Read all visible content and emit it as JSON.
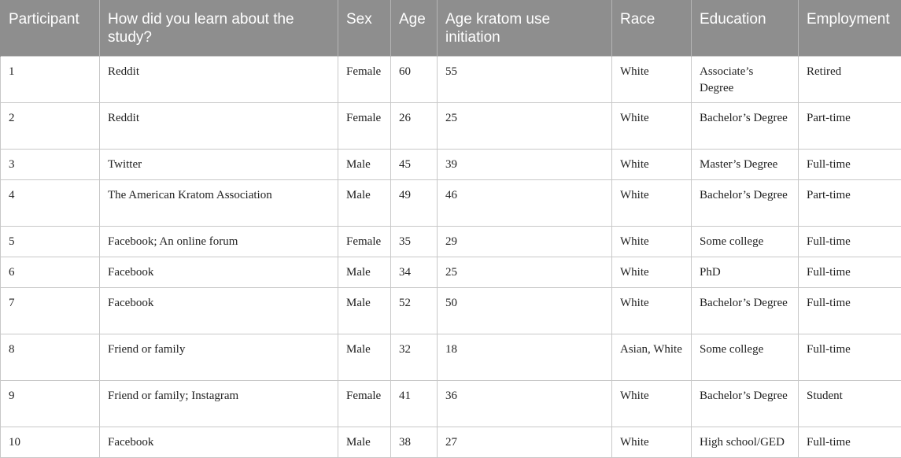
{
  "table": {
    "headers": [
      "Participant",
      "How did you learn about the study?",
      "Sex",
      "Age",
      "Age kratom use initiation",
      "Race",
      "Education",
      "Employment"
    ],
    "rows": [
      [
        "1",
        "Reddit",
        "Female",
        "60",
        "55",
        "White",
        "Associate’s Degree",
        "Retired"
      ],
      [
        "2",
        "Reddit",
        "Female",
        "26",
        "25",
        "White",
        "Bachelor’s Degree",
        "Part-time"
      ],
      [
        "3",
        "Twitter",
        "Male",
        "45",
        "39",
        "White",
        "Master’s Degree",
        "Full-time"
      ],
      [
        "4",
        "The American Kratom Association",
        "Male",
        "49",
        "46",
        "White",
        "Bachelor’s Degree",
        "Part-time"
      ],
      [
        "5",
        "Facebook; An online forum",
        "Female",
        "35",
        "29",
        "White",
        "Some college",
        "Full-time"
      ],
      [
        "6",
        "Facebook",
        "Male",
        "34",
        "25",
        "White",
        "PhD",
        "Full-time"
      ],
      [
        "7",
        "Facebook",
        "Male",
        "52",
        "50",
        "White",
        "Bachelor’s Degree",
        "Full-time"
      ],
      [
        "8",
        "Friend or family",
        "Male",
        "32",
        "18",
        "Asian, White",
        "Some college",
        "Full-time"
      ],
      [
        "9",
        "Friend or family; Instagram",
        "Female",
        "41",
        "36",
        "White",
        "Bachelor’s Degree",
        "Student"
      ],
      [
        "10",
        "Facebook",
        "Male",
        "38",
        "27",
        "White",
        "High school/GED",
        "Full-time"
      ]
    ]
  }
}
